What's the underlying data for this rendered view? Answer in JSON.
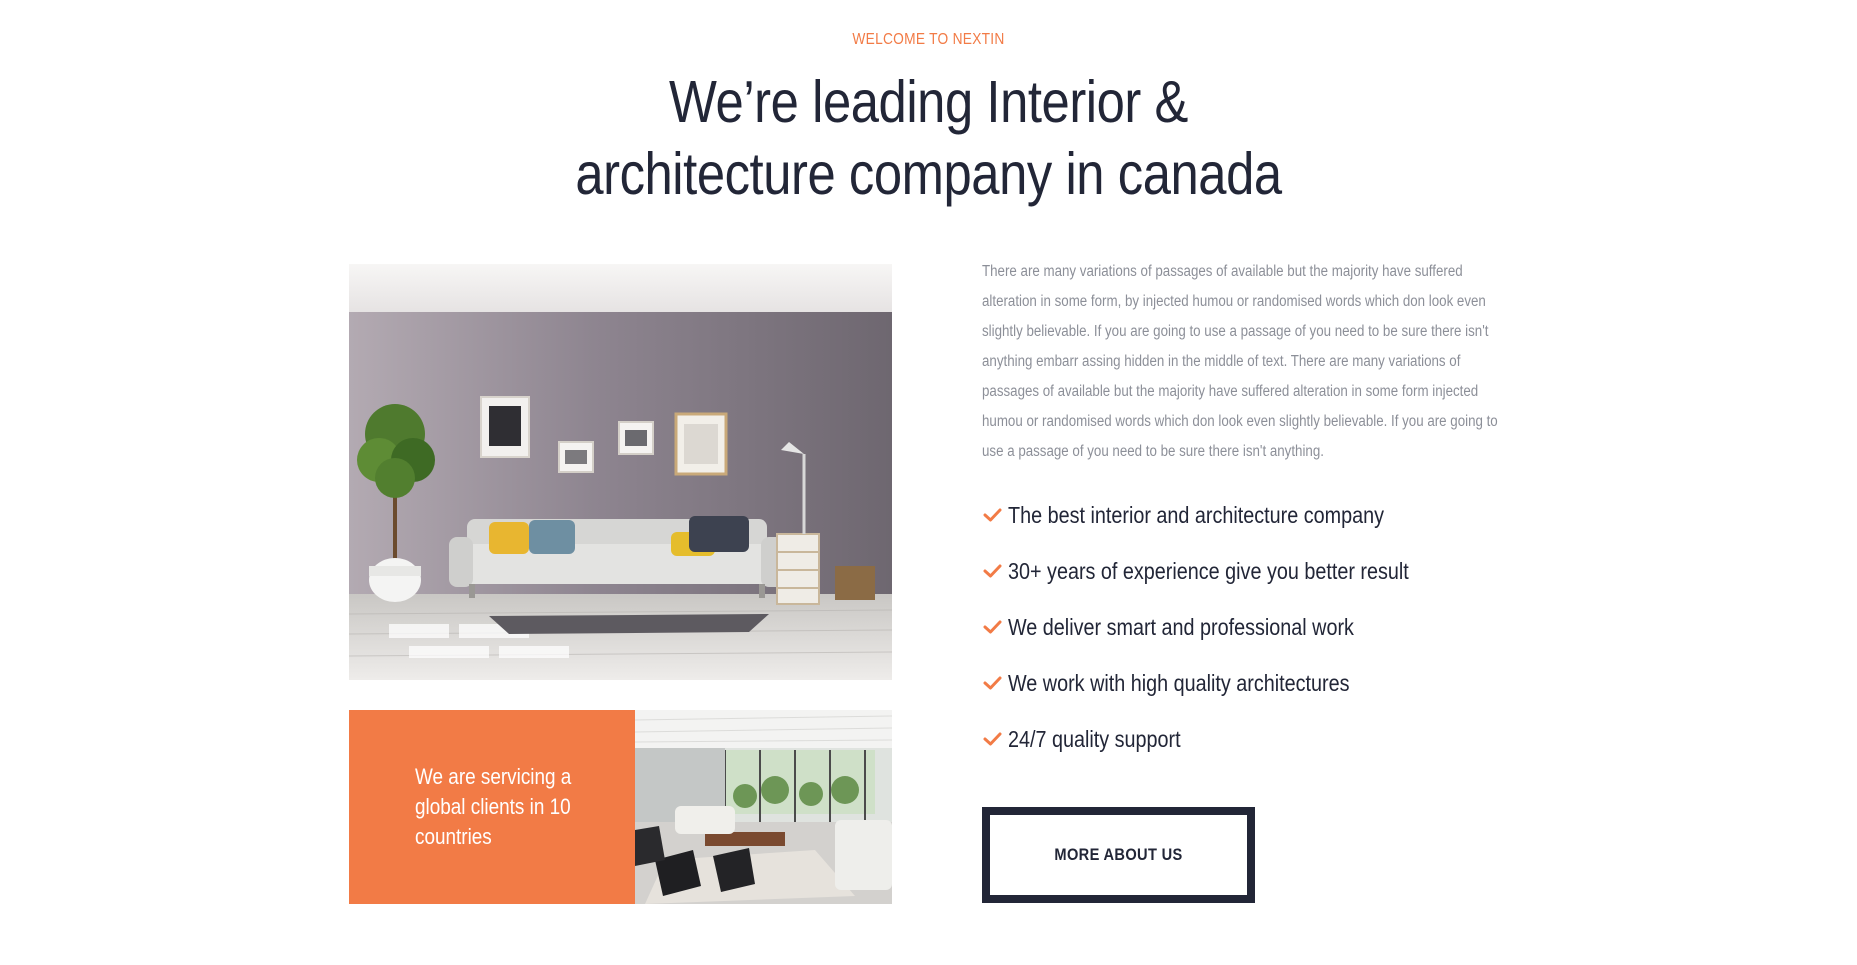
{
  "header": {
    "eyebrow": "WELCOME TO NEXTIN",
    "headline_line1": "We’re leading Interior &",
    "headline_line2": "architecture company in canada"
  },
  "intro": {
    "paragraph": "There are many variations of passages of available but the majority have suffered alteration in some form, by injected humou or randomised words which don look even slightly believable. If you are going to use a passage of you need to be sure there isn't anything embarr assing hidden in the middle of text. There are many variations of passages of available but the majority have suffered alteration in some form injected humou or randomised words which don look even slightly believable. If you are going to use a passage of you need to be sure there isn't anything."
  },
  "features": [
    "The best interior and architecture company",
    "30+ years of experience give you better result",
    "We deliver smart and professional work",
    "We work with high quality architectures",
    "24/7 quality support"
  ],
  "promo": {
    "text": "We are servicing a global clients in 10 countries"
  },
  "cta": {
    "label": "MORE ABOUT US"
  },
  "colors": {
    "accent": "#f27b46",
    "heading": "#222637",
    "body_text": "#8c8f98"
  },
  "icons": {
    "feature_bullet": "check-icon"
  }
}
